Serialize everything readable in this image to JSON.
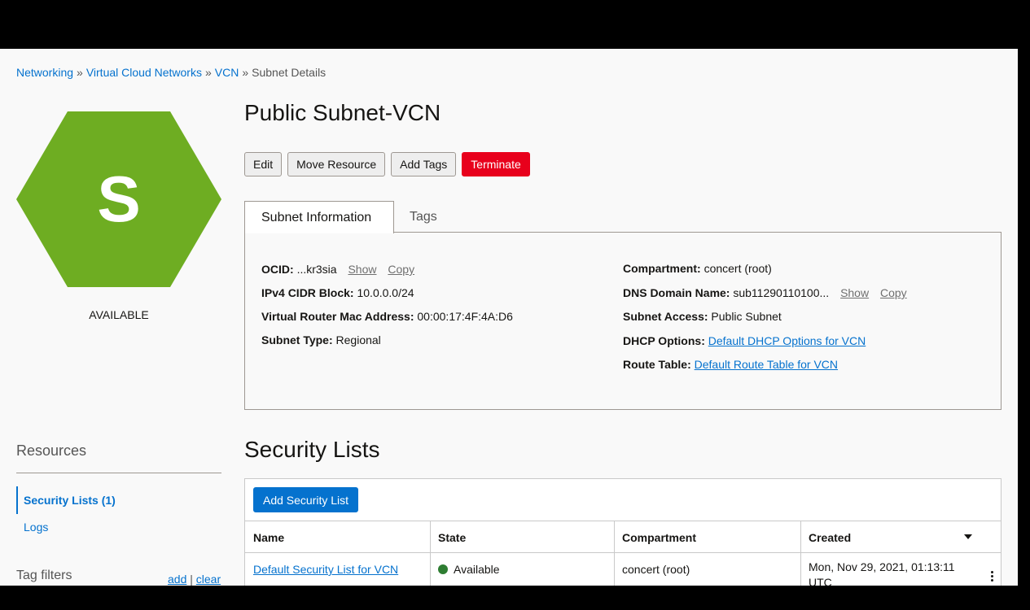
{
  "breadcrumb": {
    "items": [
      "Networking",
      "Virtual Cloud Networks",
      "VCN"
    ],
    "current": "Subnet Details",
    "separator": "»"
  },
  "resource": {
    "icon_letter": "S",
    "icon_color": "#6ead22",
    "status": "AVAILABLE",
    "title": "Public Subnet-VCN"
  },
  "actions": {
    "edit": "Edit",
    "move": "Move Resource",
    "add_tags": "Add Tags",
    "terminate": "Terminate"
  },
  "tabs": {
    "info": "Subnet Information",
    "tags": "Tags"
  },
  "info": {
    "ocid_label": "OCID:",
    "ocid_value": "...kr3sia",
    "show": "Show",
    "copy": "Copy",
    "cidr_label": "IPv4 CIDR Block:",
    "cidr_value": "10.0.0.0/24",
    "mac_label": "Virtual Router Mac Address:",
    "mac_value": "00:00:17:4F:4A:D6",
    "type_label": "Subnet Type:",
    "type_value": "Regional",
    "compartment_label": "Compartment:",
    "compartment_value": "concert (root)",
    "dns_label": "DNS Domain Name:",
    "dns_value": "sub11290110100...",
    "access_label": "Subnet Access:",
    "access_value": "Public Subnet",
    "dhcp_label": "DHCP Options:",
    "dhcp_value": "Default DHCP Options for VCN",
    "route_label": "Route Table:",
    "route_value": "Default Route Table for VCN"
  },
  "resources": {
    "title": "Resources",
    "items": [
      "Security Lists (1)",
      "Logs"
    ],
    "tag_filters": "Tag filters",
    "add": "add",
    "divider": "|",
    "clear": "clear"
  },
  "security_lists": {
    "title": "Security Lists",
    "add_button": "Add Security List",
    "columns": [
      "Name",
      "State",
      "Compartment",
      "Created"
    ],
    "rows": [
      {
        "name": "Default Security List for VCN",
        "state": "Available",
        "compartment": "concert (root)",
        "created": "Mon, Nov 29, 2021, 01:13:11 UTC"
      }
    ]
  },
  "colors": {
    "link": "#0572ce",
    "danger": "#e8001c",
    "available": "#2e7d32"
  }
}
